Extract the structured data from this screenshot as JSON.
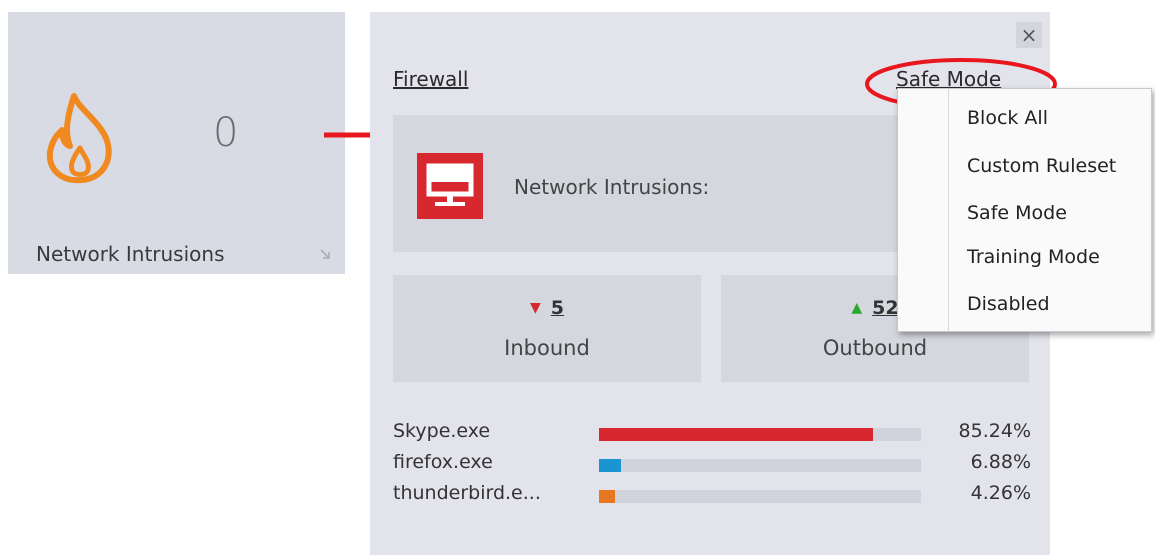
{
  "tile": {
    "count": "0",
    "label": "Network Intrusions"
  },
  "panel": {
    "title": "Firewall",
    "current_mode": "Safe Mode",
    "intrusions_label": "Network Intrusions:",
    "inbound": {
      "value": "5",
      "label": "Inbound"
    },
    "outbound": {
      "value": "52",
      "label": "Outbound"
    },
    "apps": [
      {
        "name": "Skype.exe",
        "percent": "85.24%",
        "fill": 0.8524,
        "color": "#d7282f"
      },
      {
        "name": "firefox.exe",
        "percent": "6.88%",
        "fill": 0.0688,
        "color": "#1b95d1"
      },
      {
        "name": "thunderbird.e...",
        "percent": "4.26%",
        "fill": 0.0426,
        "color": "#e87722"
      }
    ]
  },
  "mode_menu": {
    "items": [
      "Block All",
      "Custom Ruleset",
      "Safe Mode",
      "Training Mode",
      "Disabled"
    ]
  },
  "colors": {
    "accent_red": "#d7282f",
    "flame_orange": "#f0891f",
    "panel_bg": "#e3e4eb"
  },
  "icons": [
    "flame-icon",
    "monitor-icon",
    "close-icon",
    "resize-icon",
    "arrow-icon",
    "triangle-down-icon",
    "triangle-up-icon"
  ]
}
